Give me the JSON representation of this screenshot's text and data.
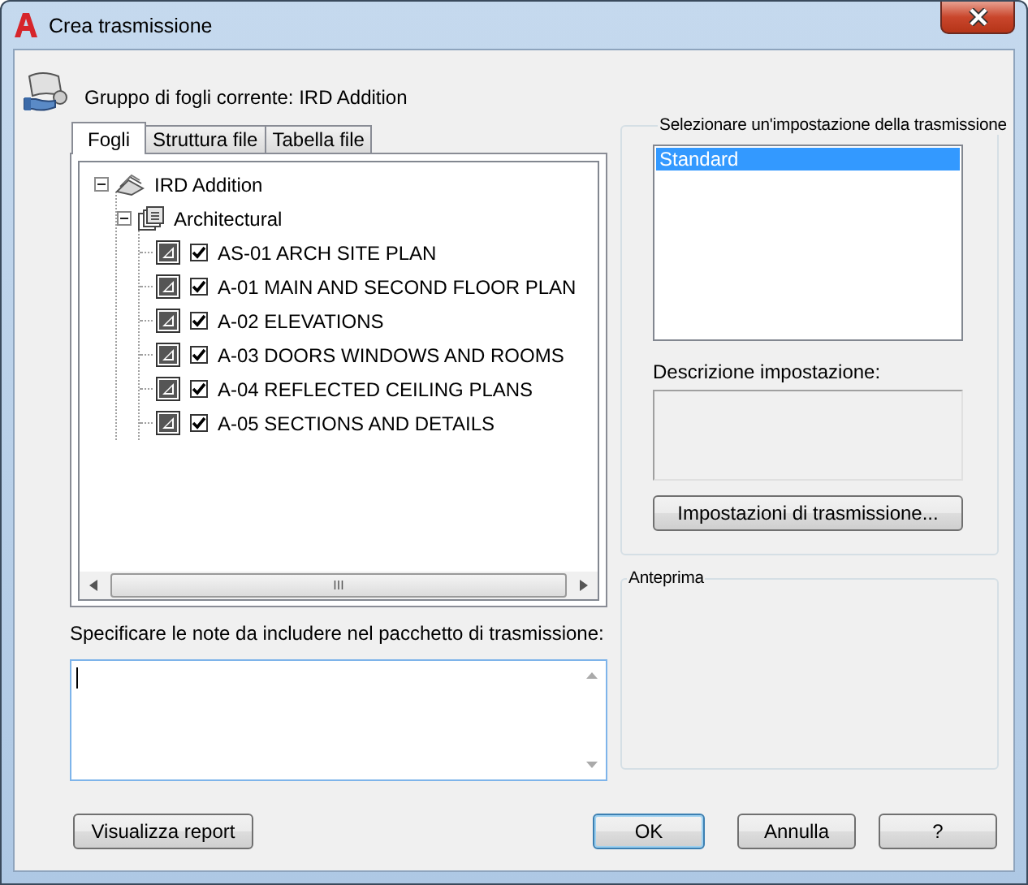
{
  "window": {
    "title": "Crea trasmissione"
  },
  "header": {
    "label": "Gruppo di fogli corrente: IRD Addition"
  },
  "tabs": [
    {
      "label": "Fogli",
      "selected": true
    },
    {
      "label": "Struttura file",
      "selected": false
    },
    {
      "label": "Tabella file",
      "selected": false
    }
  ],
  "tree": [
    {
      "label": "IRD Addition",
      "kind": "sheet_set",
      "expanded": true,
      "children": [
        {
          "label": "Architectural",
          "kind": "subset",
          "expanded": true,
          "children": [
            {
              "label": "AS-01 ARCH SITE PLAN",
              "kind": "sheet",
              "checked": true
            },
            {
              "label": "A-01 MAIN AND SECOND FLOOR PLAN",
              "kind": "sheet",
              "checked": true
            },
            {
              "label": "A-02 ELEVATIONS",
              "kind": "sheet",
              "checked": true
            },
            {
              "label": "A-03 DOORS WINDOWS AND ROOMS",
              "kind": "sheet",
              "checked": true
            },
            {
              "label": "A-04 REFLECTED CEILING PLANS",
              "kind": "sheet",
              "checked": true
            },
            {
              "label": "A-05 SECTIONS AND DETAILS",
              "kind": "sheet",
              "checked": true
            }
          ]
        }
      ]
    }
  ],
  "scroll_thumb_grip": "III",
  "notes": {
    "label": "Specificare le note da includere nel pacchetto di trasmissione:"
  },
  "setup_group": {
    "title": "Selezionare un'impostazione della trasmissione",
    "items": [
      {
        "label": "Standard",
        "selected": true
      }
    ],
    "description_label": "Descrizione impostazione:",
    "button": "Impostazioni di trasmissione..."
  },
  "preview_group": {
    "title": "Anteprima"
  },
  "buttons": [
    {
      "label": "Visualizza report",
      "kind": "report"
    },
    {
      "label": "OK",
      "kind": "default"
    },
    {
      "label": "Annulla",
      "kind": "normal"
    },
    {
      "label": "?",
      "kind": "normal"
    }
  ]
}
